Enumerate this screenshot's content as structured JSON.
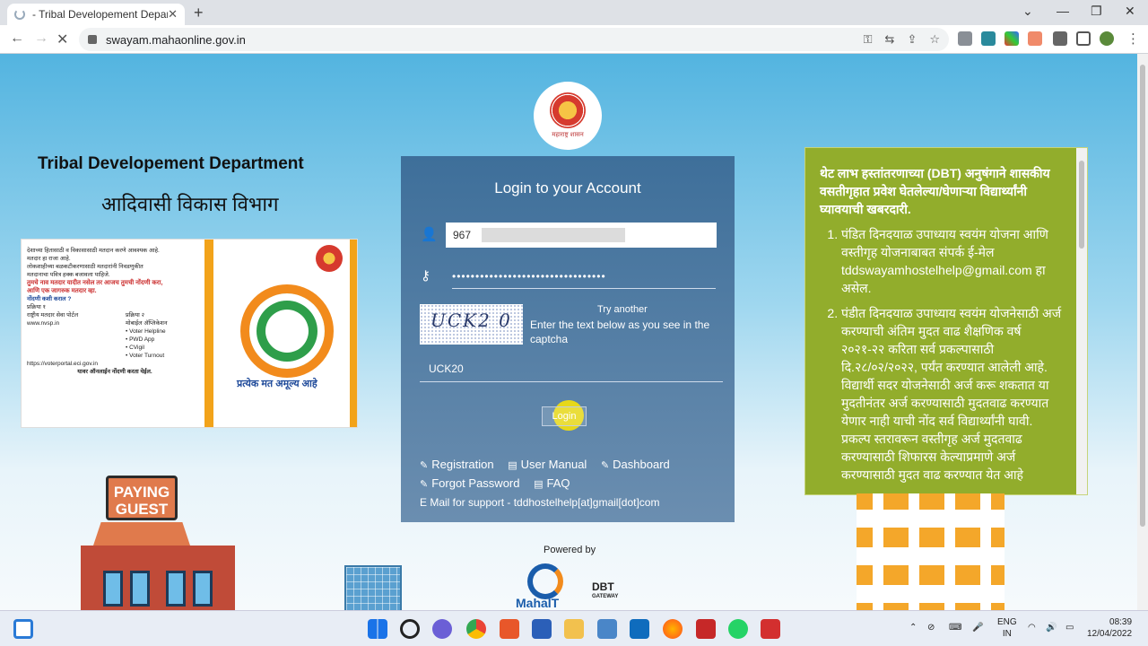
{
  "browser": {
    "tab_title": "- Tribal Developement Departme",
    "tab_close": "✕",
    "new_tab": "+",
    "url": "swayam.mahaonline.gov.in",
    "win_min": "—",
    "win_max": "❐",
    "win_close": "✕",
    "chevron": "⌄"
  },
  "page": {
    "logo_caption": "महाराष्ट्र शासन",
    "dept_en": "Tribal Developement Department",
    "dept_mr": "आदिवासी विकास विभाग",
    "poster": {
      "l1": "देशाच्या हितासाठी व विकासासाठी मतदान करणे आवश्यक आहे.",
      "l2": "मतदार हा राजा आहे.",
      "l3": "लोकशाहीच्या बळकटीकरणासाठी मतदारांनी निवडणुकीत",
      "l4": "मतदानाचा पवित्र हक्क बजावला पाहिजे.",
      "red1": "तुमचे नाव मतदार यादीत नसेल तर आजच तुमची नोंदणी करा,",
      "red2": "आणि एक जागरुक मतदार व्हा.",
      "q": "नोंदणी कशी कराल ?",
      "p1": "प्रक्रिया १",
      "p2": "प्रक्रिया २",
      "a1": "राष्ट्रीय मतदार सेवा पोर्टल",
      "a2": "मोबाईल ॲप्लिकेशन",
      "items": [
        "Voter Helpline",
        "PWD App",
        "CVigil",
        "Voter Turnout"
      ],
      "site1": "www.nvsp.in",
      "site2": "https://voterportal.eci.gov.in",
      "foot": "यावर ऑनलाईन नोंदणी करता येईल.",
      "slogan": "प्रत्येक मत अमूल्य आहे"
    },
    "login": {
      "title": "Login to your Account",
      "username": "967",
      "password": "•••••••••••••••••••••••••••••••••",
      "captcha_text": "UCK2 0",
      "try_another": "Try another",
      "captcha_info": "Enter the text below as you see in the captcha",
      "captcha_input": "UCK20",
      "login_button": "Login",
      "links": {
        "registration": "Registration",
        "user_manual": "User Manual",
        "dashboard": "Dashboard",
        "forgot": "Forgot Password",
        "faq": "FAQ"
      },
      "support": "E Mail for support - tddhostelhelp[at]gmail[dot]com"
    },
    "notice": {
      "heading": "थेट लाभ हस्तांतरणाच्या (DBT) अनुषंगाने शासकीय वसतीगृहात प्रवेश घेतलेल्या/घेणाऱ्या विद्यार्थ्यांनी घ्यावयाची खबरदारी.",
      "items": [
        "पंडित दिनदयाळ उपाध्याय स्वयंम योजना आणि वस्तीगृह योजनाबाबत संपर्क ई-मेल tddswayamhostelhelp@gmail.com हा असेल.",
        "पंडीत दिनदयाळ उपाध्याय स्वयंम योजनेसाठी अर्ज करण्याची अंतिम मुदत वाढ शैक्षणिक वर्ष २०२१-२२ करिता सर्व प्रकल्पासाठी दि.२८/०२/२०२२, पर्यंत करण्यात आलेली आहे. विद्यार्थी सदर योजनेसाठी अर्ज करू शकतात या मुदतीनंतर अर्ज करण्यासाठी मुदतवाढ करण्यात येणार नाही याची नोंद सर्व विद्यार्थ्यांनी घावी. प्रकल्प स्तरावरून वस्तीगृह अर्ज मुदतवाढ करण्यासाठी शिफारस केल्याप्रमाणे अर्ज करण्यासाठी मुदत वाढ करण्यात येत आहे"
      ]
    },
    "powered_by": "Powered by",
    "mahait": "MahaIT",
    "dbt": "DBT",
    "dbt_sub": "GATEWAY",
    "pg_sign": "PAYING GUEST"
  },
  "taskbar": {
    "lang1": "ENG",
    "lang2": "IN",
    "time": "08:39",
    "date": "12/04/2022"
  }
}
